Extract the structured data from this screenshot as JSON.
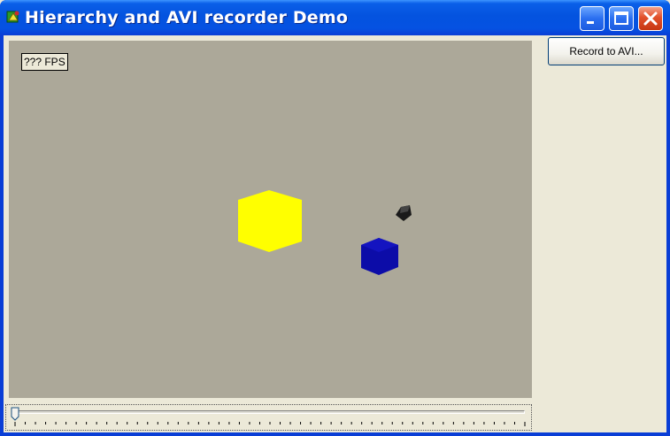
{
  "window": {
    "title": "Hierarchy and AVI recorder Demo",
    "icons": {
      "app": "app-icon",
      "minimize": "minimize-icon",
      "maximize": "maximize-icon",
      "close": "close-icon"
    }
  },
  "viewport": {
    "fps_label": "??? FPS",
    "background_color": "#aca899",
    "objects": [
      {
        "name": "yellow-cube",
        "color": "#ffff00"
      },
      {
        "name": "blue-cube",
        "color": "#0c0ca8"
      },
      {
        "name": "black-cube",
        "color": "#1a1a1a"
      }
    ]
  },
  "toolbar": {
    "record_label": "Record to AVI..."
  },
  "slider": {
    "value": 0
  }
}
